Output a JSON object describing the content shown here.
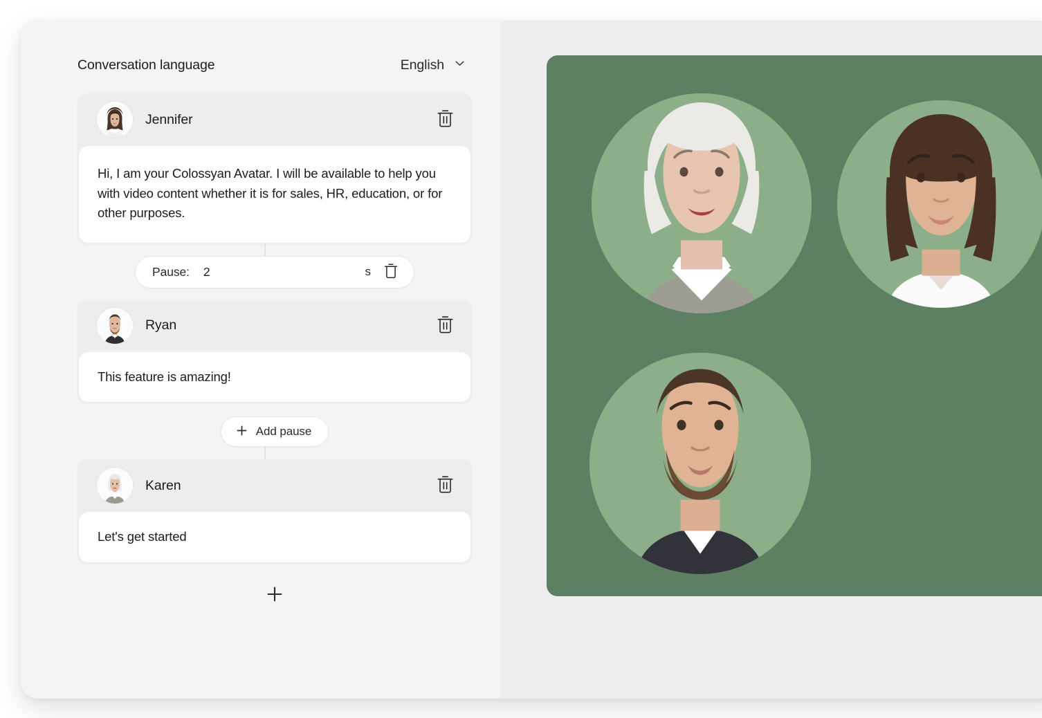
{
  "language_row": {
    "label": "Conversation language",
    "selected": "English",
    "chevron_icon": "chevron-down-icon"
  },
  "conversation": {
    "blocks": [
      {
        "type": "speaker",
        "name": "Jennifer",
        "avatar_icon": "avatar-jennifer",
        "text": "Hi, I am your Colossyan Avatar. I will be available to help you with video content whether it is for sales, HR, education, or for other purposes.",
        "delete_icon": "trash-icon"
      },
      {
        "type": "pause",
        "label": "Pause:",
        "value": "2",
        "unit": "s",
        "delete_icon": "trash-icon"
      },
      {
        "type": "speaker",
        "name": "Ryan",
        "avatar_icon": "avatar-ryan",
        "text": "This feature is amazing!",
        "delete_icon": "trash-icon"
      },
      {
        "type": "add_pause",
        "label": "Add pause",
        "plus_icon": "plus-icon"
      },
      {
        "type": "speaker",
        "name": "Karen",
        "avatar_icon": "avatar-karen",
        "text": "Let's get started",
        "delete_icon": "trash-icon"
      }
    ],
    "add_block_icon": "plus-icon"
  },
  "preview": {
    "background_color": "#5e8062",
    "circle_color": "#8cae88",
    "avatars": [
      {
        "name": "Karen",
        "icon": "avatar-karen-large"
      },
      {
        "name": "Jennifer",
        "icon": "avatar-jennifer-large"
      },
      {
        "name": "Ryan",
        "icon": "avatar-ryan-large"
      }
    ]
  }
}
